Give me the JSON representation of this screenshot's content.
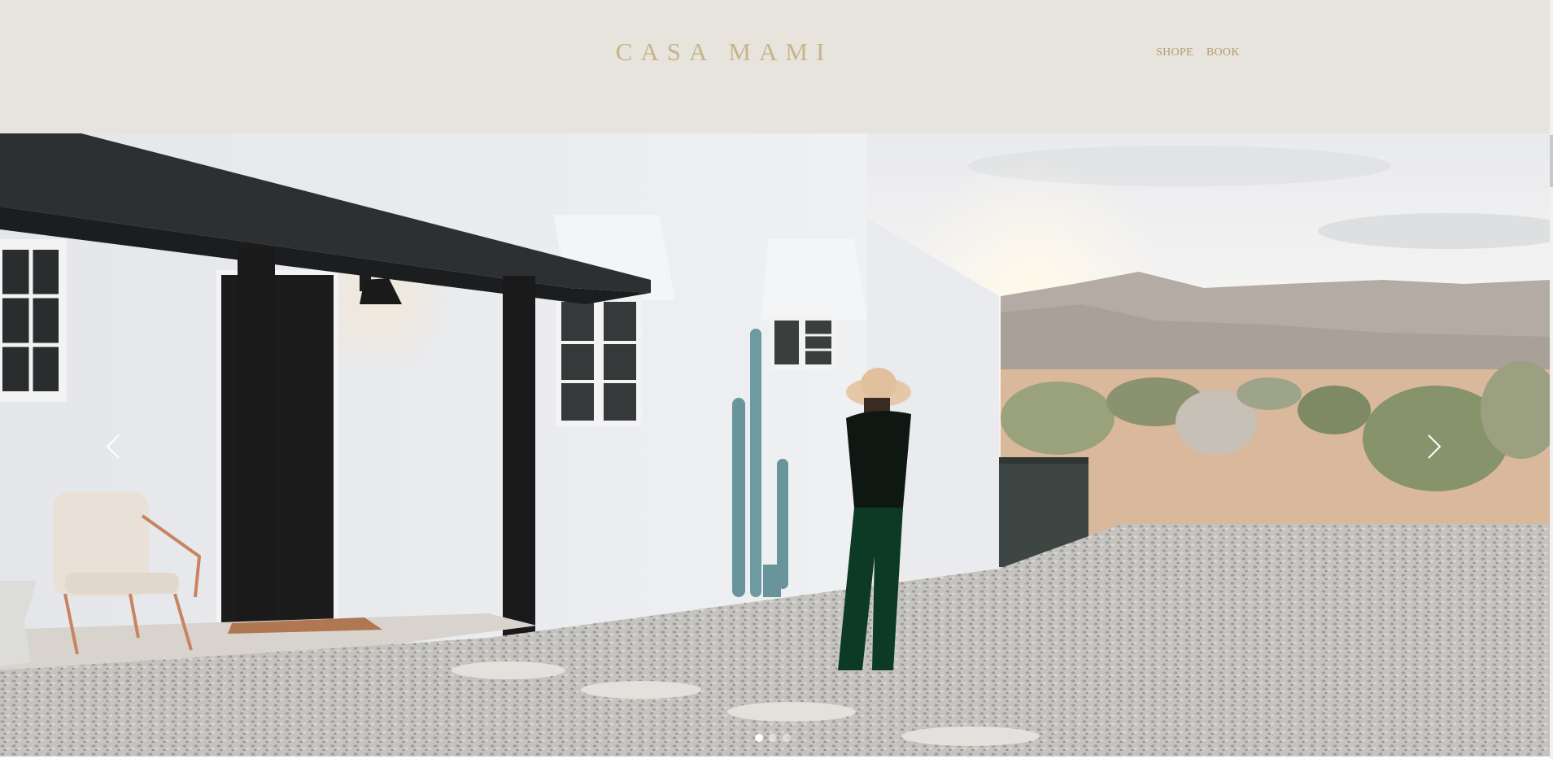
{
  "header": {
    "brand": "CASA MAMI",
    "nav": [
      {
        "label": "SHOPE"
      },
      {
        "label": "BOOK"
      }
    ]
  },
  "slider": {
    "prev_icon": "chevron-left-icon",
    "next_icon": "chevron-right-icon",
    "slide_count": 3,
    "active_slide": 1
  },
  "colors": {
    "header_bg": "#e7e4dd",
    "brand": "#c7b48a",
    "nav": "#b39c6f"
  }
}
